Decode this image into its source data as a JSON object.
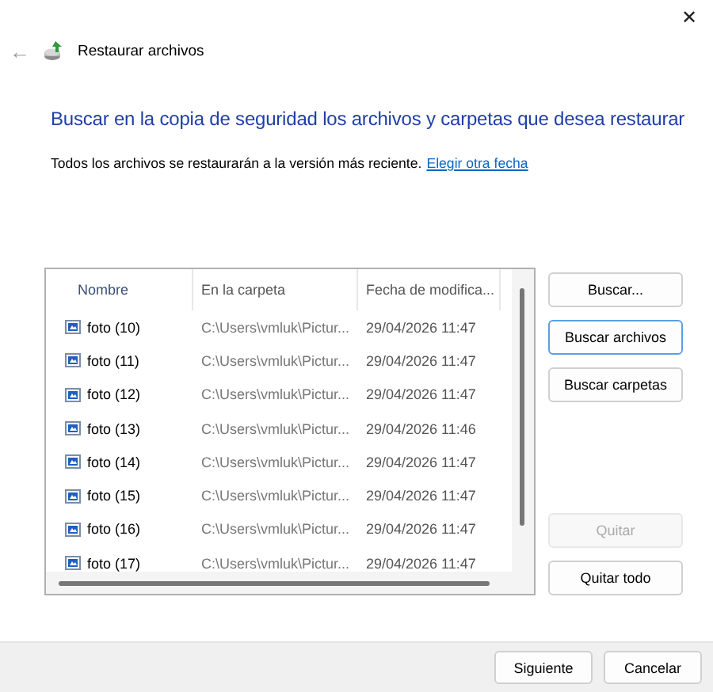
{
  "window": {
    "close": "✕",
    "back": "←",
    "title": "Restaurar archivos"
  },
  "heading": "Buscar en la copia de seguridad los archivos y carpetas que desea restaurar",
  "description": {
    "text": "Todos los archivos se restaurarán a la versión más reciente.",
    "link": "Elegir otra fecha"
  },
  "table": {
    "columns": [
      "Nombre",
      "En la carpeta",
      "Fecha de modifica..."
    ],
    "rows": [
      {
        "name": "foto (10)",
        "folder": "C:\\Users\\vmluk\\Pictur...",
        "date": "29/04/2026 11:47"
      },
      {
        "name": "foto (11)",
        "folder": "C:\\Users\\vmluk\\Pictur...",
        "date": "29/04/2026 11:47"
      },
      {
        "name": "foto (12)",
        "folder": "C:\\Users\\vmluk\\Pictur...",
        "date": "29/04/2026 11:47"
      },
      {
        "name": "foto (13)",
        "folder": "C:\\Users\\vmluk\\Pictur...",
        "date": "29/04/2026 11:46"
      },
      {
        "name": "foto (14)",
        "folder": "C:\\Users\\vmluk\\Pictur...",
        "date": "29/04/2026 11:47"
      },
      {
        "name": "foto (15)",
        "folder": "C:\\Users\\vmluk\\Pictur...",
        "date": "29/04/2026 11:47"
      },
      {
        "name": "foto (16)",
        "folder": "C:\\Users\\vmluk\\Pictur...",
        "date": "29/04/2026 11:47"
      },
      {
        "name": "foto (17)",
        "folder": "C:\\Users\\vmluk\\Pictur...",
        "date": "29/04/2026 11:47"
      }
    ]
  },
  "side_buttons": [
    {
      "label": "Buscar...",
      "focused": false,
      "disabled": false
    },
    {
      "label": "Buscar archivos",
      "focused": true,
      "disabled": false
    },
    {
      "label": "Buscar carpetas",
      "focused": false,
      "disabled": false
    },
    {
      "label": "Quitar",
      "focused": false,
      "disabled": true
    },
    {
      "label": "Quitar todo",
      "focused": false,
      "disabled": false
    }
  ],
  "footer_buttons": [
    "Siguiente",
    "Cancelar"
  ]
}
